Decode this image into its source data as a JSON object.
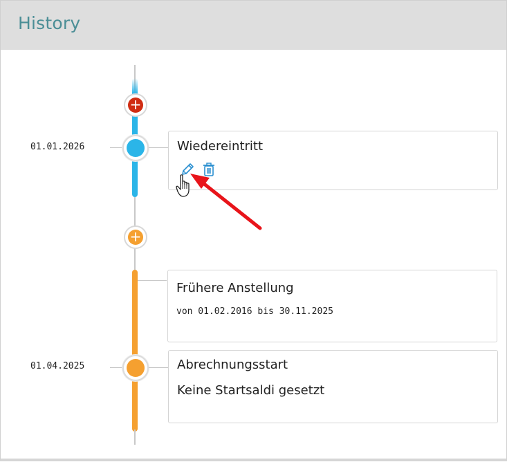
{
  "panel": {
    "title": "History"
  },
  "colors": {
    "accent_blue": "#2bb5e8",
    "accent_orange": "#f5a030",
    "add_red": "#d02c12",
    "title_teal": "#4b8e96",
    "icon_blue": "#2a8fd0",
    "annotation_red": "#e8141a"
  },
  "timeline": {
    "add_buttons": [
      {
        "symbol": "+",
        "color": "#d02c12",
        "icon": "plus-icon"
      },
      {
        "symbol": "+",
        "color": "#f5a030",
        "icon": "plus-icon"
      }
    ],
    "entries": [
      {
        "date": "01.01.2026",
        "title": "Wiedereintritt",
        "actions": [
          {
            "icon": "edit-pencil-icon",
            "label": "Edit"
          },
          {
            "icon": "trash-icon",
            "label": "Delete"
          }
        ]
      },
      {
        "title": "Frühere Anstellung",
        "subtitle": "von 01.02.2016 bis 30.11.2025"
      },
      {
        "date": "01.04.2025",
        "title": "Abrechnungsstart",
        "text": "Keine Startsaldi gesetzt"
      }
    ]
  }
}
